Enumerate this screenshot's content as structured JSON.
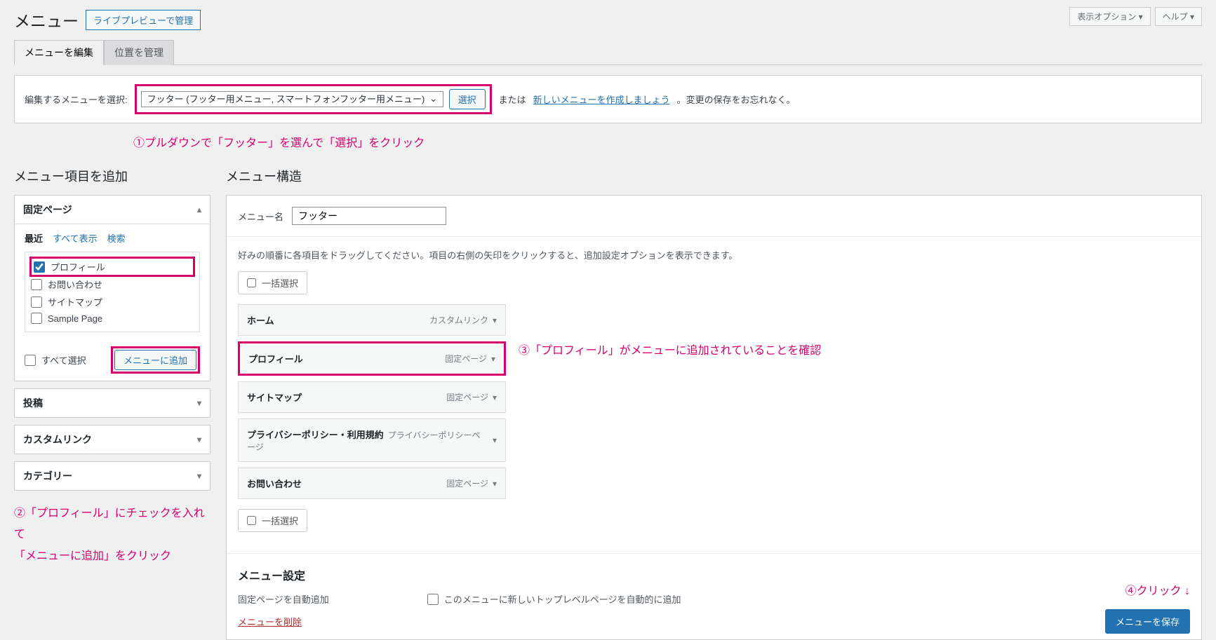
{
  "topbar": {
    "screen_options": "表示オプション ▾",
    "help": "ヘルプ ▾"
  },
  "page": {
    "title": "メニュー",
    "live_preview": "ライブプレビューで管理"
  },
  "tabs": {
    "edit": "メニューを編集",
    "locations": "位置を管理"
  },
  "manage": {
    "label": "編集するメニューを選択:",
    "select_value": "フッター (フッター用メニュー, スマートフォンフッター用メニュー)",
    "select_btn": "選択",
    "or": "または",
    "create_link": "新しいメニューを作成しましょう",
    "after": "。変更の保存をお忘れなく。"
  },
  "annotations": {
    "a1": "①プルダウンで「フッター」を選んで「選択」をクリック",
    "a2_line1": "②「プロフィール」にチェックを入れて",
    "a2_line2": "「メニューに追加」をクリック",
    "a3": "③「プロフィール」がメニューに追加されていることを確認",
    "a4": "④クリック ↓"
  },
  "left": {
    "heading": "メニュー項目を追加",
    "boxes": {
      "pages": {
        "title": "固定ページ",
        "tabs": {
          "recent": "最近",
          "all": "すべて表示",
          "search": "検索"
        },
        "items": [
          {
            "label": "プロフィール",
            "checked": true,
            "highlight": true
          },
          {
            "label": "お問い合わせ",
            "checked": false
          },
          {
            "label": "サイトマップ",
            "checked": false
          },
          {
            "label": "Sample Page",
            "checked": false
          }
        ],
        "select_all": "すべて選択",
        "add_btn": "メニューに追加"
      },
      "posts": "投稿",
      "custom": "カスタムリンク",
      "categories": "カテゴリー"
    }
  },
  "right": {
    "heading": "メニュー構造",
    "name_label": "メニュー名",
    "name_value": "フッター",
    "hint": "好みの順番に各項目をドラッグしてください。項目の右側の矢印をクリックすると、追加設定オプションを表示できます。",
    "bulk": "一括選択",
    "items": [
      {
        "title": "ホーム",
        "sub": "",
        "type": "カスタムリンク",
        "hl": false
      },
      {
        "title": "プロフィール",
        "sub": "",
        "type": "固定ページ",
        "hl": true
      },
      {
        "title": "サイトマップ",
        "sub": "",
        "type": "固定ページ",
        "hl": false
      },
      {
        "title": "プライバシーポリシー・利用規約",
        "sub": "プライバシーポリシーページ",
        "type": "",
        "hl": false
      },
      {
        "title": "お問い合わせ",
        "sub": "",
        "type": "固定ページ",
        "hl": false
      }
    ],
    "settings": {
      "title": "メニュー設定",
      "auto_add_label": "固定ページを自動追加",
      "auto_add_check": "このメニューに新しいトップレベルページを自動的に追加"
    },
    "delete": "メニューを削除",
    "save": "メニューを保存"
  }
}
